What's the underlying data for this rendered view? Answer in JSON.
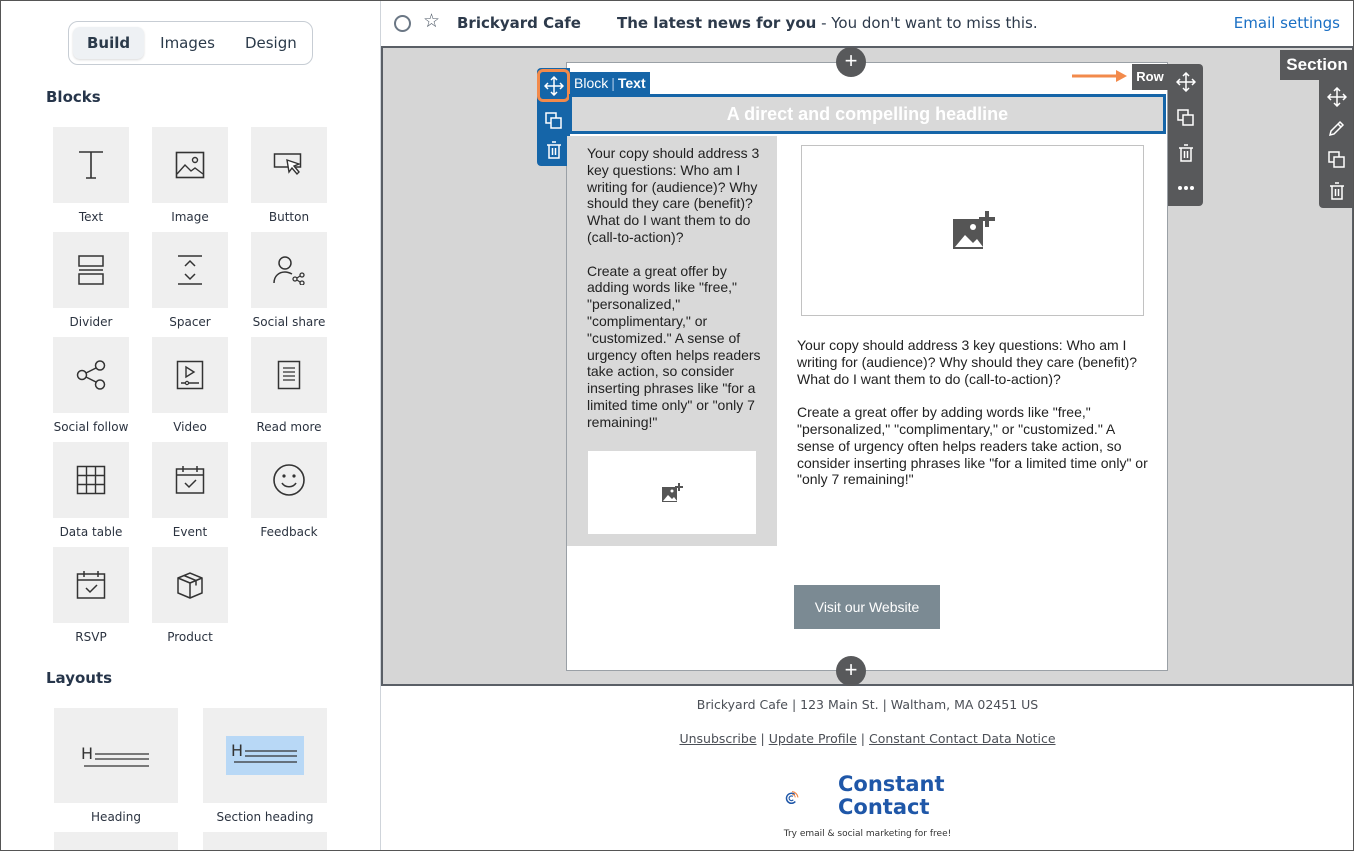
{
  "sidebar": {
    "tabs": [
      {
        "label": "Build",
        "active": true
      },
      {
        "label": "Images",
        "active": false
      },
      {
        "label": "Design",
        "active": false
      }
    ],
    "blocks_title": "Blocks",
    "blocks": [
      {
        "label": "Text",
        "icon": "text-icon"
      },
      {
        "label": "Image",
        "icon": "image-icon"
      },
      {
        "label": "Button",
        "icon": "button-icon"
      },
      {
        "label": "Divider",
        "icon": "divider-icon"
      },
      {
        "label": "Spacer",
        "icon": "spacer-icon"
      },
      {
        "label": "Social share",
        "icon": "social-share-icon"
      },
      {
        "label": "Social follow",
        "icon": "social-follow-icon"
      },
      {
        "label": "Video",
        "icon": "video-icon"
      },
      {
        "label": "Read more",
        "icon": "read-more-icon"
      },
      {
        "label": "Data table",
        "icon": "data-table-icon"
      },
      {
        "label": "Event",
        "icon": "event-icon"
      },
      {
        "label": "Feedback",
        "icon": "feedback-icon"
      },
      {
        "label": "RSVP",
        "icon": "rsvp-icon"
      },
      {
        "label": "Product",
        "icon": "product-icon"
      }
    ],
    "layouts_title": "Layouts",
    "layouts": [
      {
        "label": "Heading",
        "icon": "heading-layout-icon",
        "highlight": false
      },
      {
        "label": "Section heading",
        "icon": "section-heading-layout-icon",
        "highlight": true
      }
    ]
  },
  "header": {
    "sender": "Brickyard Cafe",
    "subject_bold": "The latest news for you",
    "subject_rest": " - You don't want to miss this.",
    "email_settings": "Email settings"
  },
  "editor": {
    "section_label": "Section",
    "row_label": "Row",
    "block_label": "Block",
    "block_type": "Text",
    "headline": "A direct and compelling headline",
    "copy_left": "Your copy should address 3 key questions: Who am I writing for (audience)? Why should they care (benefit)? What do I want them to do (call-to-action)?\n\nCreate a great offer by adding words like \"free,\" \"personalized,\" \"complimentary,\" or \"customized.\" A sense of urgency often helps readers take action, so consider inserting phrases like \"for a limited time only\" or \"only 7 remaining!\"",
    "copy_right": "Your copy should address 3 key questions: Who am I writing for (audience)? Why should they care (benefit)? What do I want them to do (call-to-action)?\n\nCreate a great offer by adding words like \"free,\" \"personalized,\" \"complimentary,\" or \"customized.\" A sense of urgency often helps readers take action, so consider inserting phrases like \"for a limited time only\" or \"only 7 remaining!\"",
    "cta_label": "Visit our Website",
    "add_symbol": "+"
  },
  "footer": {
    "address": "Brickyard Cafe | 123 Main St. | Waltham, MA 02451 US",
    "links": [
      "Unsubscribe",
      "Update Profile",
      "Constant Contact Data Notice"
    ],
    "separator": " | ",
    "logo_line1": "Constant",
    "logo_line2": "Contact",
    "tagline": "Try email & social marketing for free!"
  },
  "colors": {
    "accent_blue": "#1565a8",
    "toolbar_gray": "#58595b",
    "highlight_orange": "#f28a4b",
    "link_blue": "#1a6fc4",
    "cta_gray": "#7b8a93"
  }
}
